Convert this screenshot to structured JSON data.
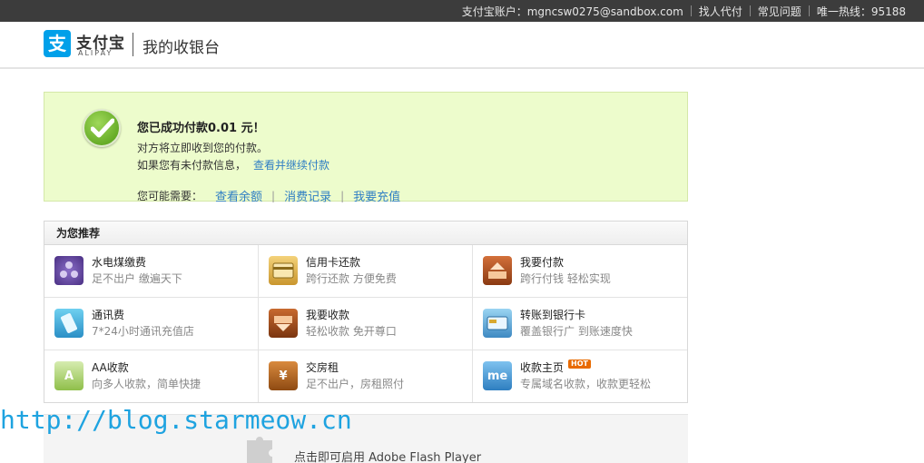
{
  "topbar": {
    "account": "支付宝账户：mgncsw0275@sandbox.com",
    "pay_for_me": "找人代付",
    "faq": "常见问题",
    "hotline": "唯一热线：95188"
  },
  "header": {
    "logo_mark": "支",
    "logo_cn": "支付宝",
    "logo_en": "ALIPAY",
    "title": "我的收银台"
  },
  "success": {
    "title": "您已成功付款0.01 元！",
    "line1": "对方将立即收到您的付款。",
    "line2": "如果您有未付款信息，",
    "continue_link": "查看并继续付款",
    "links_label": "您可能需要：",
    "link_balance": "查看余额",
    "link_records": "消费记录",
    "link_recharge": "我要充值"
  },
  "recommend": {
    "title": "为您推荐",
    "items": [
      {
        "title": "水电煤缴费",
        "desc": "足不出户  缴遍天下"
      },
      {
        "title": "信用卡还款",
        "desc": "跨行还款  方便免费"
      },
      {
        "title": "我要付款",
        "desc": "跨行付钱  轻松实现"
      },
      {
        "title": "通讯费",
        "desc": "7*24小时通讯充值店"
      },
      {
        "title": "我要收款",
        "desc": "轻松收款  免开尊口"
      },
      {
        "title": "转账到银行卡",
        "desc": "覆盖银行广  到账速度快"
      },
      {
        "title": "AA收款",
        "desc": "向多人收款，简单快捷"
      },
      {
        "title": "交房租",
        "desc": "足不出户，房租照付"
      },
      {
        "title": "收款主页",
        "desc": "专属域名收款，收款更轻松",
        "badge": "HOT"
      }
    ],
    "icon_glyphs": {
      "aa": "A",
      "house": "¥",
      "me": "me"
    }
  },
  "watermark": "http://blog.starmeow.cn",
  "flash": {
    "text": "点击即可启用 Adobe Flash Player"
  }
}
